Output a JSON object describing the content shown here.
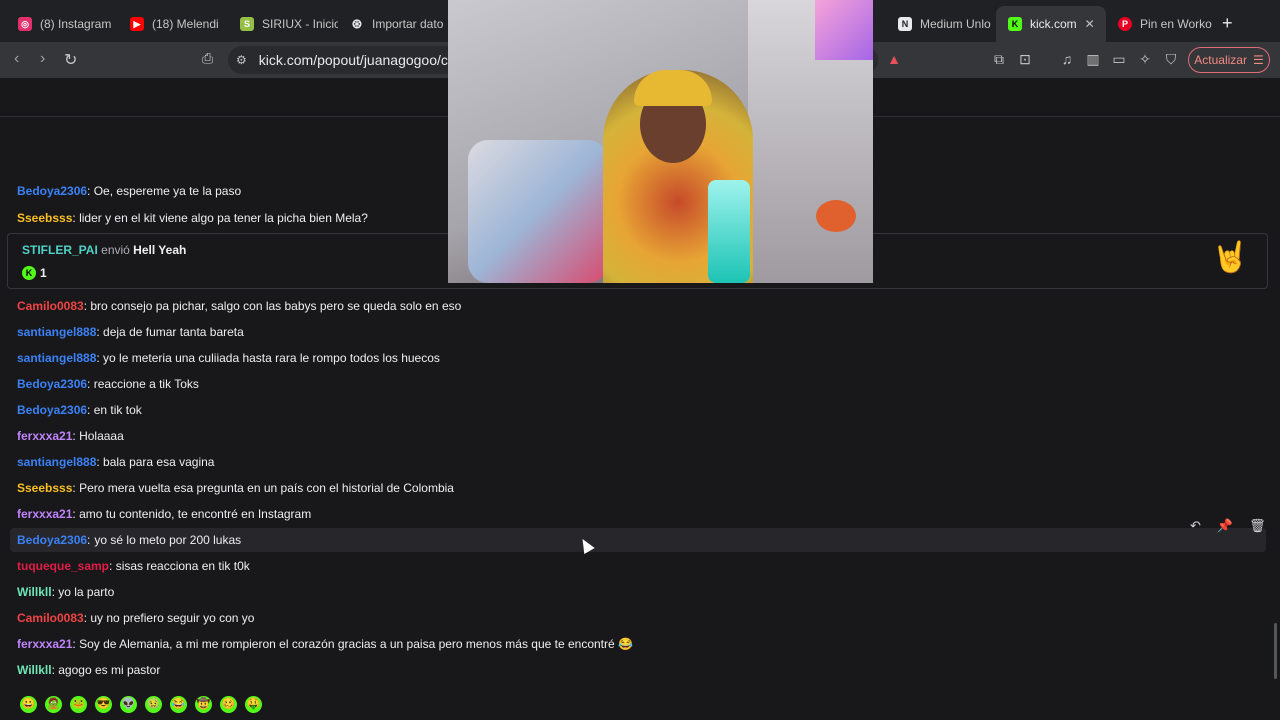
{
  "tabs": [
    {
      "title": "(8) Instagram",
      "favicon": "instagram-icon",
      "color": "#e1306c"
    },
    {
      "title": "(18) Melendi",
      "favicon": "youtube-icon",
      "color": "#ff0000"
    },
    {
      "title": "SIRIUX - Inicio",
      "favicon": "shopify-icon",
      "color": "#95bf47"
    },
    {
      "title": "Importar dato",
      "favicon": "openai-icon",
      "color": "#e8eaed"
    },
    {
      "title": "Medium Unlo",
      "favicon": "notion-icon",
      "color": "#e8eaed"
    },
    {
      "title": "kick.com",
      "favicon": "kick-icon",
      "color": "#53fc18"
    },
    {
      "title": "Pin en Worko",
      "favicon": "pinterest-icon",
      "color": "#e60023"
    }
  ],
  "address_bar": {
    "url": "kick.com/popout/juanagogoo/cha"
  },
  "toolbar": {
    "update_label": "Actualizar"
  },
  "chat": {
    "messages": [
      {
        "user": "Bedoya2306",
        "text": "Oe, espereme ya te la paso",
        "color": "#3b82f6"
      },
      {
        "user": "Sseebsss",
        "text": "lider y en el kit viene algo pa tener la picha bien Mela?",
        "color": "#fbbf24"
      },
      {
        "user": "Camilo0083",
        "text": "bro consejo pa pichar, salgo con las babys pero se queda solo en eso",
        "color": "#ef4444"
      },
      {
        "user": "santiangel888",
        "text": "deja de fumar tanta bareta",
        "color": "#3b82f6"
      },
      {
        "user": "santiangel888",
        "text": "yo le meteria una culiiada hasta rara le rompo todos los huecos",
        "color": "#3b82f6"
      },
      {
        "user": "Bedoya2306",
        "text": "reaccione a tik Toks",
        "color": "#3b82f6"
      },
      {
        "user": "Bedoya2306",
        "text": "en tik tok",
        "color": "#3b82f6"
      },
      {
        "user": "ferxxxa21",
        "text": "Holaaaa",
        "color": "#c084fc"
      },
      {
        "user": "santiangel888",
        "text": "bala para esa vagina",
        "color": "#3b82f6"
      },
      {
        "user": "Sseebsss",
        "text": "Pero mera vuelta esa pregunta en un país con el historial de Colombia",
        "color": "#fbbf24"
      },
      {
        "user": "ferxxxa21",
        "text": "amo tu contenido, te encontré en Instagram",
        "color": "#c084fc"
      },
      {
        "user": "Bedoya2306",
        "text": "yo sé lo meto por 200 lukas",
        "color": "#3b82f6"
      },
      {
        "user": "tuqueque_samp",
        "text": "sisas reacciona en tik t0k",
        "color": "#e11d48"
      },
      {
        "user": "Willkll",
        "text": "yo la parto",
        "color": "#6ee7b7"
      },
      {
        "user": "Camilo0083",
        "text": "uy no prefiero seguir yo con yo",
        "color": "#ef4444"
      },
      {
        "user": "ferxxxa21",
        "text": "Soy de Alemania, a mi me rompieron el corazón gracias a un paisa pero menos más que te encontré 😂",
        "color": "#c084fc"
      },
      {
        "user": "Willkll",
        "text": "agogo es mi pastor",
        "color": "#6ee7b7"
      }
    ],
    "gift": {
      "user": "STIFLER_PAI",
      "verb": "envió",
      "item": "Hell Yeah",
      "count": "1"
    }
  },
  "emotes": [
    "😀",
    "🧟",
    "🐸",
    "😎",
    "👽",
    "🤢",
    "😂",
    "🤠",
    "🥴",
    "🤑"
  ]
}
